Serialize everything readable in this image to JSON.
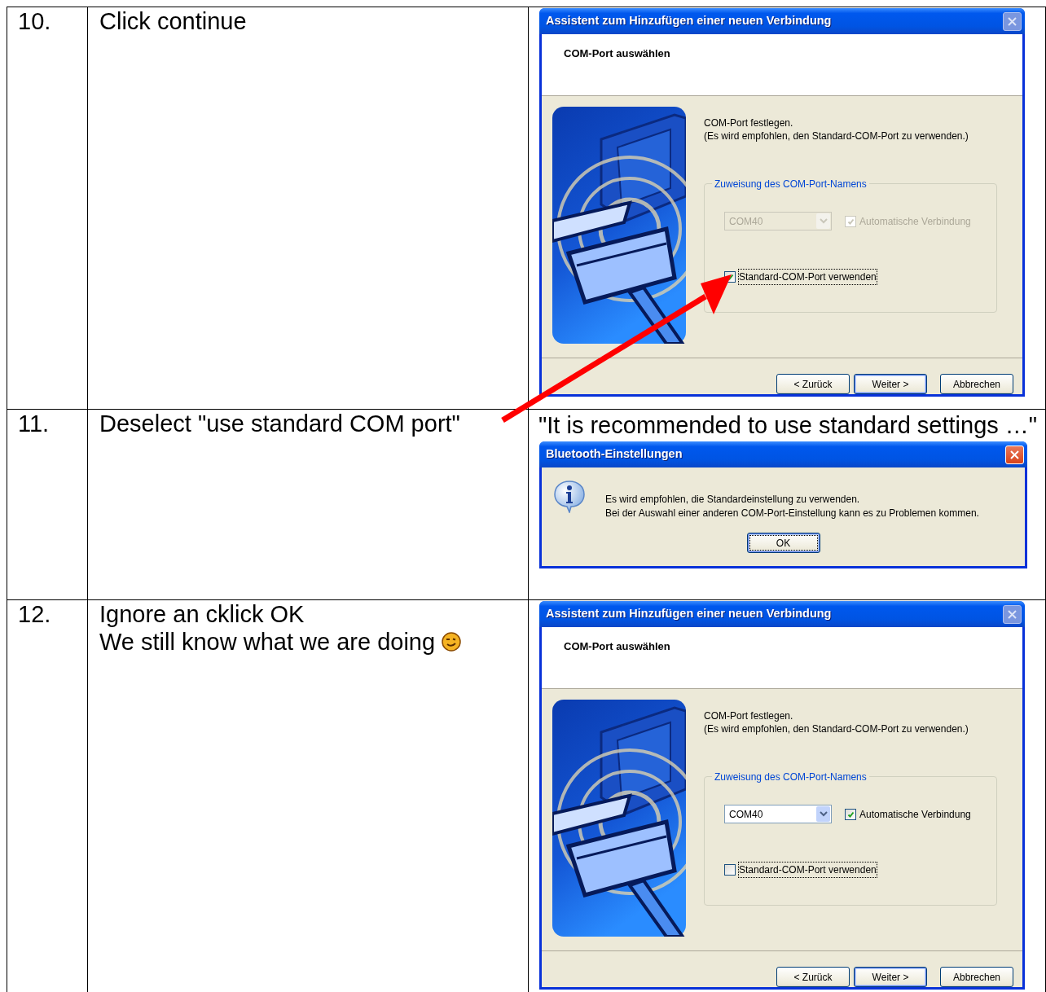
{
  "steps": [
    {
      "number": "10.",
      "instruction_lines": [
        "Click continue"
      ],
      "dialog": {
        "kind": "wizard",
        "title": "Assistent zum Hinzufügen einer neuen Verbindung",
        "close_enabled": false,
        "header": "COM-Port auswählen",
        "intro_lines": [
          "COM-Port festlegen.",
          "(Es wird empfohlen, den Standard-COM-Port zu verwenden.)"
        ],
        "group_title": "Zuweisung des COM-Port-Namens",
        "combo": {
          "value": "COM40",
          "disabled": true
        },
        "auto_connect": {
          "label": "Automatische Verbindung",
          "checked": true,
          "disabled": true
        },
        "standard_port": {
          "label": "Standard-COM-Port verwenden",
          "checked": true
        },
        "buttons": [
          {
            "label": "< Zurück",
            "default": false
          },
          {
            "label": "Weiter >",
            "default": true
          },
          {
            "label": "Abbrechen",
            "default": false
          }
        ]
      }
    },
    {
      "number": "11.",
      "instruction_lines": [
        "Deselect \"use standard COM port\""
      ],
      "caption": "\"It is recommended to use standard settings …\"",
      "dialog": {
        "kind": "message",
        "title": "Bluetooth-Einstellungen",
        "close_enabled": true,
        "lines": [
          "Es wird empfohlen, die Standardeinstellung zu verwenden.",
          "Bei der Auswahl einer anderen COM-Port-Einstellung kann es zu Problemen kommen."
        ],
        "buttons": [
          {
            "label": "OK",
            "default": true
          }
        ]
      }
    },
    {
      "number": "12.",
      "instruction_lines": [
        "Ignore an cklick OK",
        "We still know what we are doing"
      ],
      "dialog": {
        "kind": "wizard",
        "title": "Assistent zum Hinzufügen einer neuen Verbindung",
        "close_enabled": false,
        "header": "COM-Port auswählen",
        "intro_lines": [
          "COM-Port festlegen.",
          "(Es wird empfohlen, den Standard-COM-Port zu verwenden.)"
        ],
        "group_title": "Zuweisung des COM-Port-Namens",
        "combo": {
          "value": "COM40",
          "disabled": false
        },
        "auto_connect": {
          "label": "Automatische Verbindung",
          "checked": true,
          "disabled": false
        },
        "standard_port": {
          "label": "Standard-COM-Port verwenden",
          "checked": false
        },
        "buttons": [
          {
            "label": "< Zurück",
            "default": false
          },
          {
            "label": "Weiter >",
            "default": true
          },
          {
            "label": "Abbrechen",
            "default": false
          }
        ]
      }
    }
  ]
}
